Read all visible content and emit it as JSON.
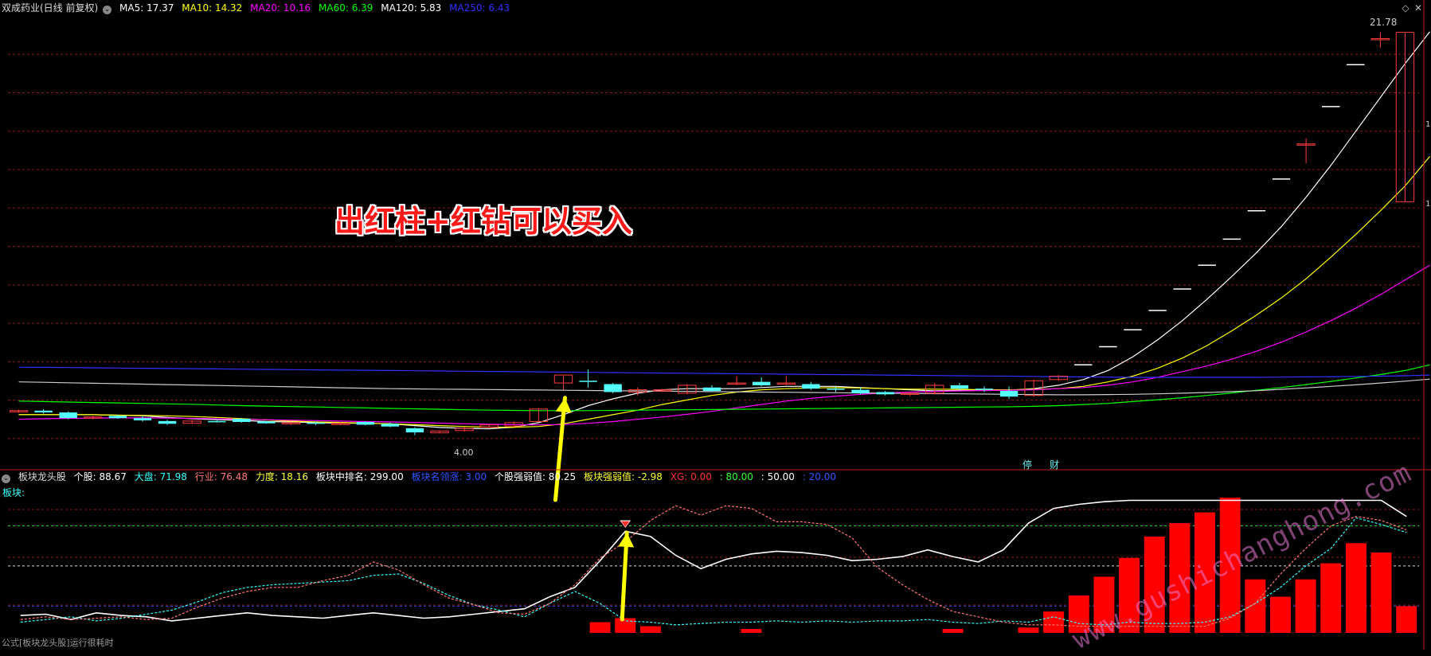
{
  "header": {
    "stock_title": "双成药业(日线 前复权)",
    "ma": [
      {
        "label": "MA5: 17.37",
        "color": "#ffffff"
      },
      {
        "label": "MA10: 14.32",
        "color": "#ffff00"
      },
      {
        "label": "MA20: 10.16",
        "color": "#ff00ff"
      },
      {
        "label": "MA60: 6.39",
        "color": "#00ff00"
      },
      {
        "label": "MA120: 5.83",
        "color": "#ffffff"
      },
      {
        "label": "MA250: 6.43",
        "color": "#3030ff"
      }
    ]
  },
  "indicator_header": {
    "name": "板块龙头股",
    "items": [
      {
        "label": "个股: 88.67",
        "color": "#ffffff"
      },
      {
        "label": "大盘: 71.98",
        "color": "#33ffff"
      },
      {
        "label": "行业: 76.48",
        "color": "#ff7777"
      },
      {
        "label": "力度: 18.16",
        "color": "#ffff33"
      },
      {
        "label": "板块中排名: 299.00",
        "color": "#ffffff"
      },
      {
        "label": "板块名领涨: 3.00",
        "color": "#3355ff"
      },
      {
        "label": "个股强弱值: 80.25",
        "color": "#ffffff"
      },
      {
        "label": "板块强弱值: -2.98",
        "color": "#ffff33"
      },
      {
        "label": "XG: 0.00",
        "color": "#ff3333"
      },
      {
        "label": ": 80.00",
        "color": "#33ff33"
      },
      {
        "label": ": 50.00",
        "color": "#ffffff"
      },
      {
        "label": ": 20.00",
        "color": "#3355ff"
      }
    ],
    "sector_label": "板块:"
  },
  "annotation": "出红柱+红钻可以买入",
  "watermark": "www.gushichanghong.com",
  "footer": "公式[板块龙头股]运行很耗时",
  "price_tags": {
    "max_label": "21.78",
    "min_label": "4.00"
  },
  "event_tags": [
    "停",
    "财"
  ],
  "right_edge_marks": [
    "1",
    "1"
  ],
  "chart_data": [
    {
      "type": "candlestick",
      "title": "双成药业(日线 前复权)",
      "ylim": [
        3.0,
        22.5
      ],
      "grid": "horizontal dashed",
      "candles": [
        {
          "o": 5.05,
          "h": 5.12,
          "l": 4.98,
          "c": 5.08
        },
        {
          "o": 5.08,
          "h": 5.15,
          "l": 4.95,
          "c": 5.0
        },
        {
          "o": 5.0,
          "h": 5.05,
          "l": 4.7,
          "c": 4.75
        },
        {
          "o": 4.75,
          "h": 4.85,
          "l": 4.7,
          "c": 4.8
        },
        {
          "o": 4.85,
          "h": 4.9,
          "l": 4.72,
          "c": 4.75
        },
        {
          "o": 4.75,
          "h": 4.82,
          "l": 4.6,
          "c": 4.65
        },
        {
          "o": 4.62,
          "h": 4.68,
          "l": 4.45,
          "c": 4.5
        },
        {
          "o": 4.52,
          "h": 4.66,
          "l": 4.5,
          "c": 4.62
        },
        {
          "o": 4.62,
          "h": 4.7,
          "l": 4.55,
          "c": 4.6
        },
        {
          "o": 4.72,
          "h": 4.76,
          "l": 4.55,
          "c": 4.58
        },
        {
          "o": 4.6,
          "h": 4.62,
          "l": 4.5,
          "c": 4.52
        },
        {
          "o": 4.5,
          "h": 4.58,
          "l": 4.45,
          "c": 4.55
        },
        {
          "o": 4.55,
          "h": 4.6,
          "l": 4.45,
          "c": 4.5
        },
        {
          "o": 4.5,
          "h": 4.58,
          "l": 4.45,
          "c": 4.52
        },
        {
          "o": 4.58,
          "h": 4.62,
          "l": 4.44,
          "c": 4.46
        },
        {
          "o": 4.5,
          "h": 4.55,
          "l": 4.35,
          "c": 4.38
        },
        {
          "o": 4.3,
          "h": 4.35,
          "l": 4.0,
          "c": 4.12
        },
        {
          "o": 4.1,
          "h": 4.2,
          "l": 4.08,
          "c": 4.18
        },
        {
          "o": 4.2,
          "h": 4.35,
          "l": 4.15,
          "c": 4.3
        },
        {
          "o": 4.35,
          "h": 4.5,
          "l": 4.3,
          "c": 4.45
        },
        {
          "o": 4.4,
          "h": 4.6,
          "l": 4.38,
          "c": 4.55
        },
        {
          "o": 4.6,
          "h": 5.2,
          "l": 4.6,
          "c": 5.15
        },
        {
          "o": 6.3,
          "h": 6.6,
          "l": 6.0,
          "c": 6.65
        },
        {
          "o": 6.4,
          "h": 6.9,
          "l": 6.1,
          "c": 6.35
        },
        {
          "o": 6.25,
          "h": 6.3,
          "l": 5.85,
          "c": 5.9
        },
        {
          "o": 5.9,
          "h": 6.1,
          "l": 5.75,
          "c": 6.0
        },
        {
          "o": 5.95,
          "h": 6.05,
          "l": 5.9,
          "c": 6.0
        },
        {
          "o": 5.85,
          "h": 6.25,
          "l": 5.8,
          "c": 6.2
        },
        {
          "o": 6.1,
          "h": 6.2,
          "l": 5.9,
          "c": 5.95
        },
        {
          "o": 6.25,
          "h": 6.6,
          "l": 6.2,
          "c": 6.3
        },
        {
          "o": 6.35,
          "h": 6.55,
          "l": 6.15,
          "c": 6.2
        },
        {
          "o": 6.25,
          "h": 6.6,
          "l": 6.2,
          "c": 6.3
        },
        {
          "o": 6.25,
          "h": 6.35,
          "l": 6.0,
          "c": 6.05
        },
        {
          "o": 6.05,
          "h": 6.15,
          "l": 5.9,
          "c": 6.0
        },
        {
          "o": 6.0,
          "h": 6.1,
          "l": 5.8,
          "c": 5.85
        },
        {
          "o": 5.9,
          "h": 5.95,
          "l": 5.75,
          "c": 5.8
        },
        {
          "o": 5.8,
          "h": 5.9,
          "l": 5.72,
          "c": 5.85
        },
        {
          "o": 5.85,
          "h": 6.3,
          "l": 5.8,
          "c": 6.2
        },
        {
          "o": 6.2,
          "h": 6.3,
          "l": 6.0,
          "c": 6.05
        },
        {
          "o": 6.05,
          "h": 6.15,
          "l": 5.9,
          "c": 6.0
        },
        {
          "o": 5.95,
          "h": 6.15,
          "l": 5.6,
          "c": 5.7
        },
        {
          "o": 5.75,
          "h": 6.45,
          "l": 5.7,
          "c": 6.4
        },
        {
          "o": 6.45,
          "h": 6.65,
          "l": 6.4,
          "c": 6.6
        },
        {
          "o": 7.1,
          "h": 7.1,
          "l": 7.1,
          "c": 7.1
        },
        {
          "o": 7.9,
          "h": 7.9,
          "l": 7.9,
          "c": 7.9
        },
        {
          "o": 8.65,
          "h": 8.65,
          "l": 8.65,
          "c": 8.65
        },
        {
          "o": 9.5,
          "h": 9.5,
          "l": 9.5,
          "c": 9.5
        },
        {
          "o": 10.45,
          "h": 10.45,
          "l": 10.45,
          "c": 10.45
        },
        {
          "o": 11.5,
          "h": 11.5,
          "l": 11.5,
          "c": 11.5
        },
        {
          "o": 12.65,
          "h": 12.65,
          "l": 12.65,
          "c": 12.65
        },
        {
          "o": 13.9,
          "h": 13.9,
          "l": 13.9,
          "c": 13.9
        },
        {
          "o": 15.3,
          "h": 15.3,
          "l": 15.3,
          "c": 15.3
        },
        {
          "o": 16.85,
          "h": 17.1,
          "l": 16.0,
          "c": 16.85
        },
        {
          "o": 18.5,
          "h": 18.5,
          "l": 18.5,
          "c": 18.5
        },
        {
          "o": 20.35,
          "h": 20.35,
          "l": 20.35,
          "c": 20.35
        },
        {
          "o": 21.5,
          "h": 21.78,
          "l": 21.1,
          "c": 21.5
        },
        {
          "o": 14.3,
          "h": 21.78,
          "l": 14.3,
          "c": 21.78
        }
      ],
      "series": [
        {
          "name": "MA5",
          "color": "#ffffff",
          "values": [
            4.9,
            4.9,
            4.9,
            4.9,
            4.88,
            4.85,
            4.78,
            4.72,
            4.68,
            4.65,
            4.6,
            4.58,
            4.55,
            4.53,
            4.52,
            4.5,
            4.42,
            4.34,
            4.3,
            4.28,
            4.35,
            4.55,
            4.9,
            5.3,
            5.6,
            5.85,
            6.0,
            6.05,
            6.05,
            6.05,
            6.1,
            6.15,
            6.15,
            6.15,
            6.1,
            6.05,
            6.0,
            5.95,
            5.98,
            6.0,
            5.98,
            6.05,
            6.2,
            6.45,
            6.85,
            7.45,
            8.2,
            9.05,
            10.0,
            11.0,
            12.05,
            13.2,
            14.5,
            15.9,
            17.4,
            18.9,
            20.4,
            21.8
          ]
        },
        {
          "name": "MA10",
          "color": "#ffff00",
          "values": [
            4.9,
            4.9,
            4.9,
            4.9,
            4.88,
            4.87,
            4.85,
            4.82,
            4.78,
            4.73,
            4.67,
            4.62,
            4.58,
            4.56,
            4.53,
            4.5,
            4.46,
            4.42,
            4.38,
            4.35,
            4.35,
            4.38,
            4.5,
            4.7,
            4.9,
            5.1,
            5.35,
            5.55,
            5.75,
            5.9,
            6.0,
            6.05,
            6.08,
            6.1,
            6.08,
            6.05,
            6.03,
            6.03,
            6.02,
            6.0,
            6.0,
            6.02,
            6.05,
            6.15,
            6.35,
            6.6,
            6.95,
            7.4,
            7.95,
            8.6,
            9.3,
            10.05,
            10.9,
            11.85,
            12.85,
            13.9,
            15.0,
            16.3
          ]
        },
        {
          "name": "MA20",
          "color": "#ff00ff",
          "values": [
            4.7,
            4.72,
            4.74,
            4.75,
            4.76,
            4.76,
            4.75,
            4.74,
            4.72,
            4.7,
            4.68,
            4.66,
            4.64,
            4.62,
            4.6,
            4.58,
            4.56,
            4.53,
            4.5,
            4.48,
            4.46,
            4.45,
            4.47,
            4.52,
            4.6,
            4.7,
            4.8,
            4.92,
            5.05,
            5.2,
            5.35,
            5.5,
            5.62,
            5.72,
            5.8,
            5.86,
            5.9,
            5.93,
            5.95,
            5.97,
            5.98,
            6.0,
            6.05,
            6.1,
            6.2,
            6.35,
            6.55,
            6.8,
            7.05,
            7.35,
            7.7,
            8.1,
            8.55,
            9.05,
            9.6,
            10.2,
            10.85,
            11.5
          ]
        },
        {
          "name": "MA60",
          "color": "#00ff00",
          "values": [
            5.5,
            5.48,
            5.46,
            5.44,
            5.42,
            5.4,
            5.38,
            5.36,
            5.33,
            5.3,
            5.28,
            5.26,
            5.24,
            5.22,
            5.2,
            5.18,
            5.16,
            5.14,
            5.12,
            5.1,
            5.09,
            5.08,
            5.08,
            5.08,
            5.09,
            5.1,
            5.11,
            5.12,
            5.13,
            5.14,
            5.15,
            5.16,
            5.17,
            5.18,
            5.19,
            5.2,
            5.21,
            5.22,
            5.23,
            5.24,
            5.25,
            5.27,
            5.3,
            5.35,
            5.4,
            5.48,
            5.56,
            5.65,
            5.75,
            5.86,
            5.98,
            6.1,
            6.23,
            6.37,
            6.52,
            6.67,
            6.85,
            7.1
          ]
        },
        {
          "name": "MA120",
          "color": "#cccccc",
          "values": [
            6.35,
            6.33,
            6.31,
            6.29,
            6.27,
            6.25,
            6.23,
            6.21,
            6.19,
            6.17,
            6.15,
            6.13,
            6.11,
            6.09,
            6.07,
            6.05,
            6.04,
            6.03,
            6.02,
            6.01,
            6.0,
            5.99,
            5.98,
            5.97,
            5.96,
            5.95,
            5.94,
            5.93,
            5.92,
            5.91,
            5.9,
            5.89,
            5.88,
            5.87,
            5.86,
            5.85,
            5.84,
            5.83,
            5.82,
            5.81,
            5.8,
            5.79,
            5.78,
            5.78,
            5.79,
            5.8,
            5.82,
            5.85,
            5.88,
            5.92,
            5.96,
            6.02,
            6.08,
            6.15,
            6.22,
            6.3,
            6.38,
            6.47
          ]
        },
        {
          "name": "MA250",
          "color": "#3030ff",
          "values": [
            7.0,
            6.99,
            6.98,
            6.97,
            6.96,
            6.95,
            6.94,
            6.93,
            6.92,
            6.91,
            6.9,
            6.89,
            6.88,
            6.87,
            6.86,
            6.85,
            6.84,
            6.83,
            6.82,
            6.81,
            6.8,
            6.79,
            6.78,
            6.77,
            6.76,
            6.75,
            6.74,
            6.73,
            6.72,
            6.71,
            6.7,
            6.69,
            6.68,
            6.67,
            6.66,
            6.65,
            6.64,
            6.63,
            6.62,
            6.61,
            6.6,
            6.59,
            6.58,
            6.57,
            6.56,
            6.55,
            6.55,
            6.55,
            6.55,
            6.55,
            6.55,
            6.56,
            6.57,
            6.58,
            6.59,
            6.6,
            6.62,
            6.65
          ]
        }
      ]
    },
    {
      "type": "bar+line",
      "title": "板块龙头股",
      "ylim": [
        0,
        110
      ],
      "reference_lines": [
        {
          "value": 80,
          "color": "#33ff33"
        },
        {
          "value": 50,
          "color": "#ffffff"
        },
        {
          "value": 20,
          "color": "#3355ff"
        }
      ],
      "bars": {
        "name": "XG",
        "color": "#ff0000",
        "values": [
          0,
          0,
          0,
          0,
          0,
          0,
          0,
          0,
          0,
          0,
          0,
          0,
          0,
          0,
          0,
          0,
          0,
          0,
          0,
          0,
          0,
          0,
          0,
          8,
          11,
          5,
          0,
          0,
          0,
          3,
          0,
          0,
          0,
          0,
          0,
          0,
          0,
          3,
          0,
          0,
          4,
          16,
          28,
          42,
          56,
          72,
          82,
          90,
          101,
          40,
          27,
          40,
          52,
          67,
          60,
          20
        ]
      },
      "series": [
        {
          "name": "个股",
          "color": "#ffffff",
          "style": "solid",
          "values": [
            13,
            14,
            10,
            15,
            13,
            12,
            9,
            11,
            13,
            15,
            13,
            12,
            11,
            13,
            15,
            13,
            11,
            12,
            14,
            16,
            18,
            27,
            34,
            54,
            76,
            72,
            58,
            48,
            55,
            59,
            61,
            60,
            58,
            54,
            55,
            57,
            62,
            57,
            53,
            62,
            82,
            93,
            96,
            98,
            99,
            99,
            99,
            99,
            99,
            99,
            99,
            99,
            99,
            99,
            99,
            87
          ]
        },
        {
          "name": "大盘",
          "color": "#33ffff",
          "style": "dashed",
          "values": [
            8,
            10,
            12,
            9,
            11,
            14,
            17,
            23,
            30,
            34,
            36,
            37,
            38,
            39,
            43,
            44,
            37,
            28,
            21,
            17,
            12,
            22,
            31,
            22,
            9,
            8,
            6,
            7,
            8,
            8,
            9,
            8,
            9,
            8,
            9,
            9,
            10,
            8,
            7,
            9,
            8,
            12,
            7,
            6,
            8,
            7,
            7,
            8,
            12,
            22,
            34,
            50,
            63,
            86,
            81,
            75
          ]
        },
        {
          "name": "行业",
          "color": "#ff7777",
          "style": "dashed",
          "values": [
            10,
            12,
            10,
            11,
            12,
            10,
            11,
            19,
            26,
            31,
            34,
            34,
            39,
            43,
            53,
            47,
            36,
            26,
            21,
            15,
            14,
            22,
            36,
            56,
            68,
            84,
            95,
            88,
            95,
            93,
            83,
            83,
            81,
            71,
            49,
            36,
            25,
            16,
            12,
            8,
            6,
            6,
            5,
            5,
            5,
            5,
            5,
            5,
            11,
            22,
            44,
            63,
            80,
            87,
            84,
            77
          ]
        }
      ],
      "markers": [
        {
          "index": 24,
          "type": "red-diamond"
        }
      ]
    }
  ]
}
